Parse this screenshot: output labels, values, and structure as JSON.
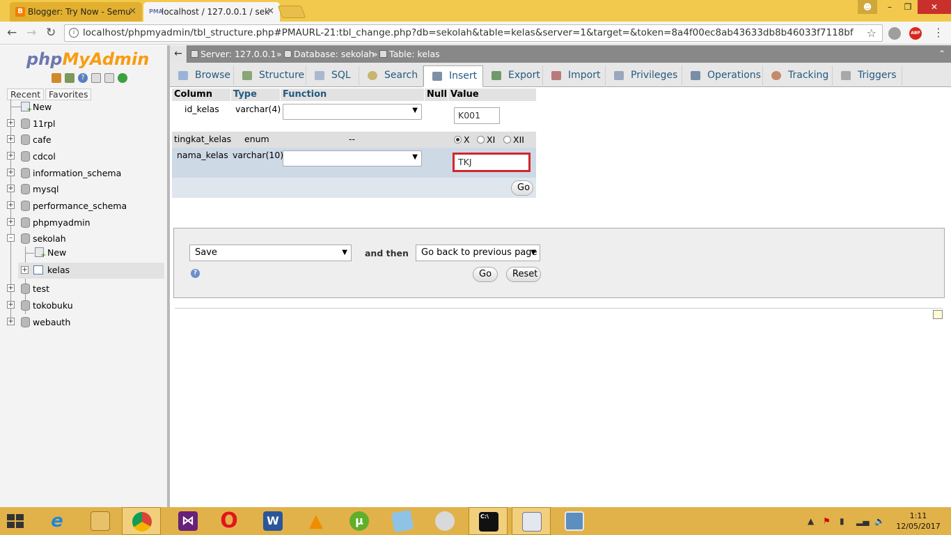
{
  "browser": {
    "tabs": [
      {
        "title": "Blogger: Try Now - Semu",
        "active": false
      },
      {
        "title": "localhost / 127.0.0.1 / sek",
        "active": true
      }
    ],
    "close_glyph": "✕",
    "url": "localhost/phpmyadmin/tbl_structure.php#PMAURL-21:tbl_change.php?db=sekolah&table=kelas&server=1&target=&token=8a4f00ec8ab43633db8b46033f7118bf",
    "abp_label": "ABP"
  },
  "pma": {
    "logo_php": "php",
    "logo_myadmin": "MyAdmin",
    "recent_label": "Recent",
    "favorites_label": "Favorites",
    "tree": {
      "new_root": "New",
      "databases": [
        "11rpl",
        "cafe",
        "cdcol",
        "information_schema",
        "mysql",
        "performance_schema",
        "phpmyadmin",
        "sekolah",
        "test",
        "tokobuku",
        "webauth"
      ],
      "sekolah_new": "New",
      "sekolah_table": "kelas"
    },
    "breadcrumb": {
      "server": "Server: 127.0.0.1",
      "database": "Database: sekolah",
      "table": "Table: kelas",
      "separator": "»"
    },
    "tabs": [
      {
        "label": "Browse",
        "icon": "browse-icon"
      },
      {
        "label": "Structure",
        "icon": "structure-icon"
      },
      {
        "label": "SQL",
        "icon": "sql-icon"
      },
      {
        "label": "Search",
        "icon": "search-icon"
      },
      {
        "label": "Insert",
        "icon": "insert-icon",
        "active": true
      },
      {
        "label": "Export",
        "icon": "export-icon"
      },
      {
        "label": "Import",
        "icon": "import-icon"
      },
      {
        "label": "Privileges",
        "icon": "privileges-icon"
      },
      {
        "label": "Operations",
        "icon": "operations-icon"
      },
      {
        "label": "Tracking",
        "icon": "tracking-icon"
      },
      {
        "label": "Triggers",
        "icon": "triggers-icon"
      }
    ],
    "insert_table": {
      "headers": {
        "column": "Column",
        "type": "Type",
        "function": "Function",
        "null": "Null",
        "value": "Value"
      },
      "rows": [
        {
          "column": "id_kelas",
          "type": "varchar(4)",
          "value": "K001"
        },
        {
          "column": "tingkat_kelas",
          "type": "enum",
          "function": "--",
          "options": [
            "X",
            "XI",
            "XII"
          ],
          "selected": "X"
        },
        {
          "column": "nama_kelas",
          "type": "varchar(10)",
          "value": "TKJ"
        }
      ],
      "go_label": "Go"
    },
    "action": {
      "save_select": "Save",
      "and_then_label": "and then",
      "after_select": "Go back to previous page",
      "go_label": "Go",
      "reset_label": "Reset"
    }
  },
  "taskbar": {
    "clock_time": "1:11",
    "clock_date": "12/05/2017"
  }
}
